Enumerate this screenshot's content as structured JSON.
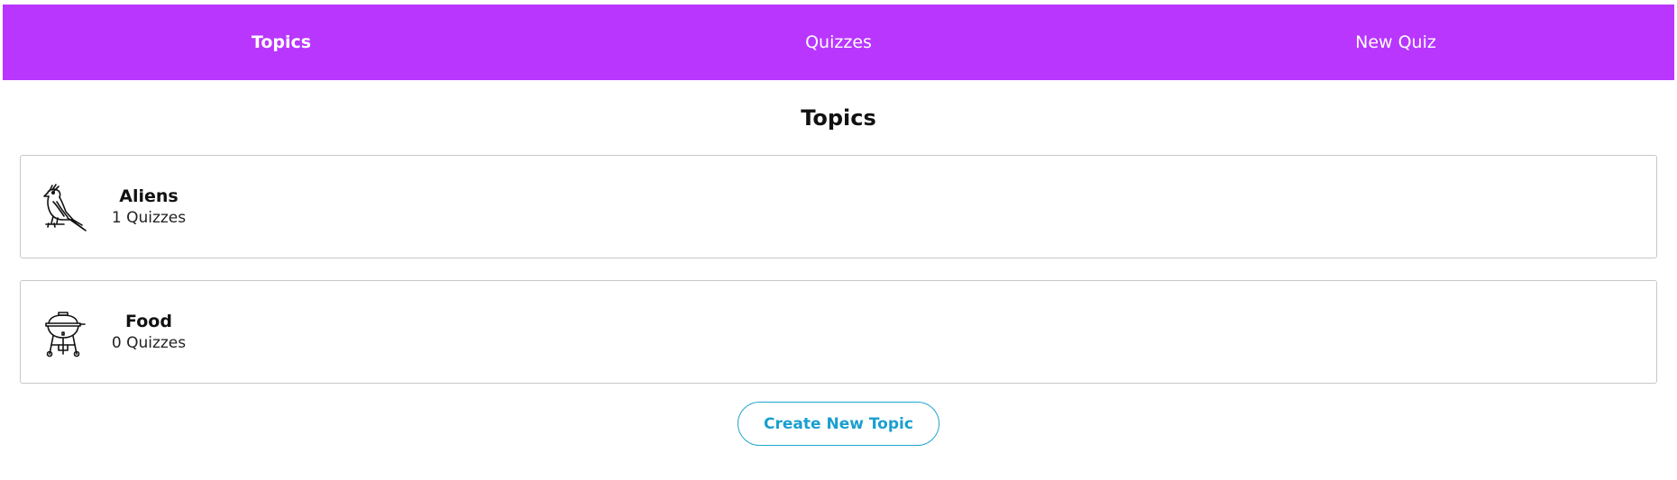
{
  "nav": {
    "items": [
      {
        "label": "Topics",
        "active": true
      },
      {
        "label": "Quizzes",
        "active": false
      },
      {
        "label": "New Quiz",
        "active": false
      }
    ],
    "background_color": "#b936ff"
  },
  "main": {
    "title": "Topics",
    "topics": [
      {
        "name": "Aliens",
        "count_text": "1 Quizzes",
        "icon": "bird-icon"
      },
      {
        "name": "Food",
        "count_text": "0 Quizzes",
        "icon": "grill-icon"
      }
    ],
    "create_button_label": "Create New Topic",
    "accent_color": "#1a9fcf"
  }
}
